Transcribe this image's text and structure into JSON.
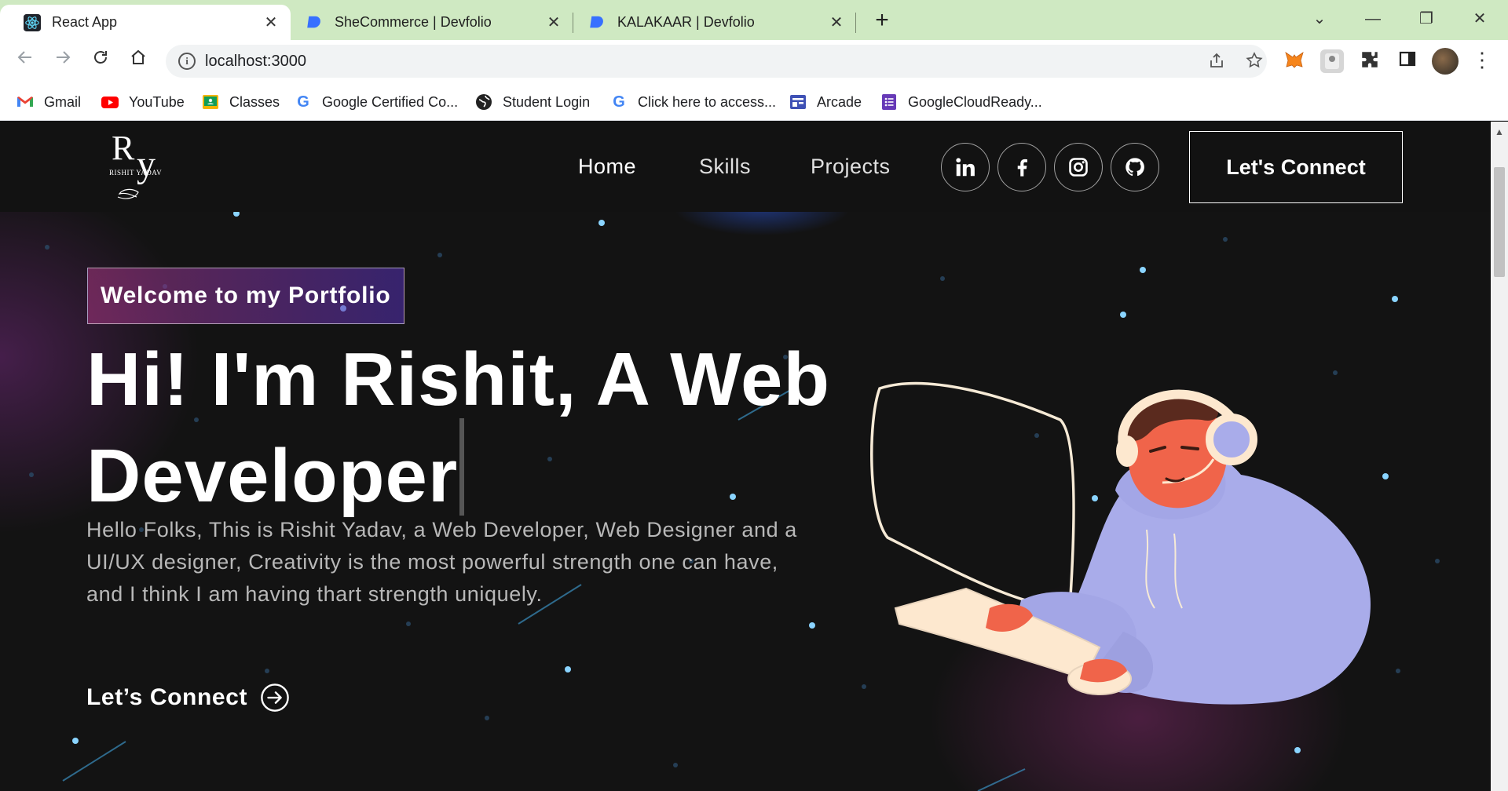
{
  "browser": {
    "tabs": [
      {
        "title": "React App",
        "favicon": "react-icon",
        "active": true
      },
      {
        "title": "SheCommerce | Devfolio",
        "favicon": "devfolio-icon",
        "active": false
      },
      {
        "title": "KALAKAAR | Devfolio",
        "favicon": "devfolio-icon",
        "active": false
      }
    ],
    "close_glyph": "✕",
    "new_tab_glyph": "+",
    "window_controls": {
      "dropdown": "⌄",
      "minimize": "—",
      "restore": "❐",
      "close": "✕"
    },
    "url": "localhost:3000",
    "bookmarks": [
      {
        "label": "Gmail",
        "icon": "gmail-icon"
      },
      {
        "label": "YouTube",
        "icon": "youtube-icon"
      },
      {
        "label": "Classes",
        "icon": "classroom-icon"
      },
      {
        "label": "Google Certified Co...",
        "icon": "google-icon"
      },
      {
        "label": "Student Login",
        "icon": "globe-icon"
      },
      {
        "label": "Click here to access...",
        "icon": "google-icon"
      },
      {
        "label": "Arcade",
        "icon": "arcade-icon"
      },
      {
        "label": "GoogleCloudReady...",
        "icon": "forms-icon"
      }
    ]
  },
  "site": {
    "logo_text": {
      "initials_r": "R",
      "initials_y": "y",
      "name": "RISHIT YADAV"
    },
    "nav": {
      "home": "Home",
      "skills": "Skills",
      "projects": "Projects"
    },
    "social": [
      "linkedin-icon",
      "facebook-icon",
      "instagram-icon",
      "github-icon"
    ],
    "connect_button": "Let's Connect",
    "banner": {
      "tagline": "Welcome to my Portfolio",
      "headline_line1": "Hi! I'm Rishit, A Web",
      "headline_line2": "Developer",
      "intro": "Hello Folks, This is Rishit Yadav, a Web Developer, Web Designer and a UI/UX designer, Creativity is the most powerful strength one can have, and I think I am having thart strength uniquely.",
      "cta": "Let’s Connect"
    }
  },
  "colors": {
    "background": "#121212",
    "tab_strip": "#cfe9c2",
    "tagline_gradient_start": "#aa367c",
    "tagline_gradient_end": "#4a2fbd",
    "hoodie": "#a9acea",
    "skin": "#f0644a"
  }
}
